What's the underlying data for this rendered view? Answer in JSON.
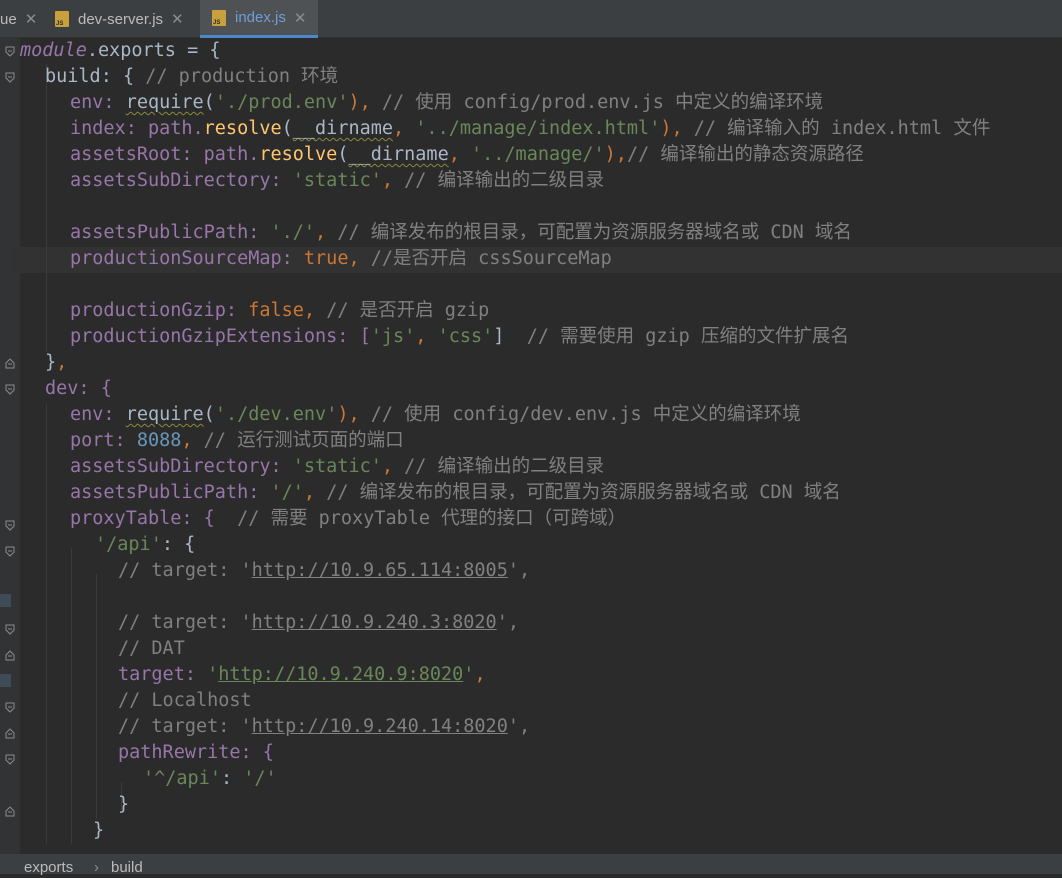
{
  "tabs": [
    {
      "label": "ue",
      "active": false
    },
    {
      "label": "dev-server.js",
      "active": false
    },
    {
      "label": "index.js",
      "active": true
    }
  ],
  "close_glyph": "✕",
  "code": {
    "l01": {
      "a": "module",
      "b": ".exports = {"
    },
    "l02": {
      "a": "build: { ",
      "b": "// production 环境"
    },
    "l03": {
      "a": "env: ",
      "b": "require",
      "c": "(",
      "d": "'./prod.env'",
      "e": "), ",
      "f": "// 使用 config/prod.env.js 中定义的编译环境"
    },
    "l04": {
      "a": "index: path.",
      "b": "resolve",
      "c": "(",
      "d": "__dirname",
      "e": ", ",
      "f": "'../manage/index.html'",
      "g": "), ",
      "h": "// 编译输入的 index.html 文件"
    },
    "l05": {
      "a": "assetsRoot: path.",
      "b": "resolve",
      "c": "(",
      "d": "__dirname",
      "e": ", ",
      "f": "'../manage/'",
      "g": "),",
      "h": "// 编译输出的静态资源路径"
    },
    "l06": {
      "a": "assetsSubDirectory: ",
      "b": "'static'",
      "c": ", ",
      "d": "// 编译输出的二级目录"
    },
    "l07": {
      "a": "assetsPublicPath: ",
      "b": "'./'",
      "c": ", ",
      "d": "// 编译发布的根目录，可配置为资源服务器域名或 CDN 域名"
    },
    "l08": {
      "a": "productionSourceMap: ",
      "b": "true",
      "c": ", ",
      "d": "//是否开启 cssSourceMap"
    },
    "l09": {
      "a": "productionGzip: ",
      "b": "false",
      "c": ", ",
      "d": "// 是否开启 gzip"
    },
    "l10": {
      "a": "productionGzipExtensions: [",
      "b": "'js'",
      "c": ", ",
      "d": "'css'",
      "e": "]  ",
      "f": "// 需要使用 gzip 压缩的文件扩展名"
    },
    "l11": {
      "a": "}",
      "b": ","
    },
    "l12": {
      "a": "dev: {"
    },
    "l13": {
      "a": "env: ",
      "b": "require",
      "c": "(",
      "d": "'./dev.env'",
      "e": "), ",
      "f": "// 使用 config/dev.env.js 中定义的编译环境"
    },
    "l14": {
      "a": "port: ",
      "b": "8088",
      "c": ", ",
      "d": "// 运行测试页面的端口"
    },
    "l15": {
      "a": "assetsSubDirectory: ",
      "b": "'static'",
      "c": ", ",
      "d": "// 编译输出的二级目录"
    },
    "l16": {
      "a": "assetsPublicPath: ",
      "b": "'/'",
      "c": ", ",
      "d": "// 编译发布的根目录，可配置为资源服务器域名或 CDN 域名"
    },
    "l17": {
      "a": "proxyTable: {  ",
      "b": "// 需要 proxyTable 代理的接口（可跨域）"
    },
    "l18": {
      "a": "'/api'",
      "b": ": {"
    },
    "l19": {
      "a": "// target: '",
      "b": "http://10.9.65.114:8005",
      "c": "',"
    },
    "l20": {
      "a": "// target: '",
      "b": "http://10.9.240.3:8020",
      "c": "',"
    },
    "l21": {
      "a": "// DAT"
    },
    "l22": {
      "a": "target: ",
      "b": "'",
      "c": "http://10.9.240.9:8020",
      "d": "'",
      "e": ","
    },
    "l23": {
      "a": "// Localhost"
    },
    "l24": {
      "a": "// target: '",
      "b": "http://10.9.240.14:8020",
      "c": "',"
    },
    "l25": {
      "a": "pathRewrite: {"
    },
    "l26": {
      "a": "'^/api'",
      "b": ": ",
      "c": "'/'"
    },
    "l27": {
      "a": "}"
    },
    "l28": {
      "a": "}"
    }
  },
  "breadcrumb": {
    "item1": "exports",
    "separator": "›",
    "item2": "build"
  },
  "colors": {
    "keyword": "#cc7832",
    "string": "#6a8759",
    "number": "#6897bb",
    "property": "#9876aa",
    "comment": "#808080",
    "function": "#ffc66d",
    "text": "#a9b7c6",
    "background": "#2b2b2b",
    "active_tab_text": "#6d9ed9"
  }
}
